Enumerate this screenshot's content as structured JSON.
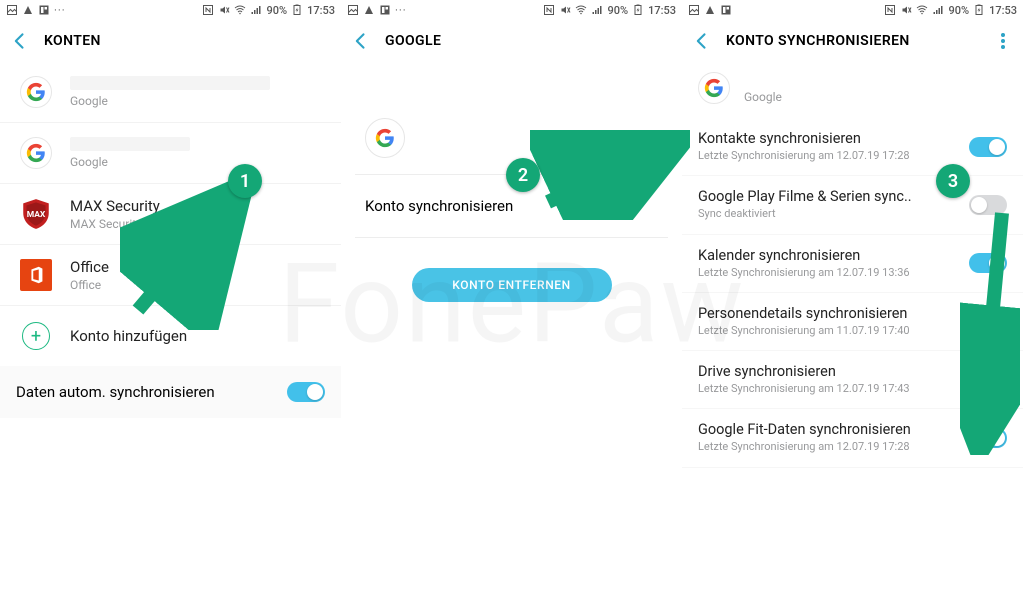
{
  "status": {
    "battery": "90%",
    "time": "17:53"
  },
  "screen1": {
    "title": "KONTEN",
    "accounts": [
      {
        "provider": "Google"
      },
      {
        "provider": "Google"
      },
      {
        "name": "MAX Security",
        "provider": "MAX Security"
      },
      {
        "name": "Office",
        "provider": "Office"
      }
    ],
    "add_account": "Konto hinzufügen",
    "auto_sync_label": "Daten autom. synchronisieren"
  },
  "screen2": {
    "title": "GOOGLE",
    "sync_label": "Konto synchronisieren",
    "remove_label": "KONTO ENTFERNEN"
  },
  "screen3": {
    "title": "KONTO SYNCHRONISIEREN",
    "provider": "Google",
    "items": [
      {
        "title": "Kontakte synchronisieren",
        "sub": "Letzte Synchronisierung am 12.07.19 17:28",
        "on": true
      },
      {
        "title": "Google Play Filme & Serien sync..",
        "sub": "Sync deaktiviert",
        "on": false
      },
      {
        "title": "Kalender synchronisieren",
        "sub": "Letzte Synchronisierung am 12.07.19 13:36",
        "on": true
      },
      {
        "title": "Personendetails synchronisieren",
        "sub": "Letzte Synchronisierung am 11.07.19 17:40",
        "on": true
      },
      {
        "title": "Drive synchronisieren",
        "sub": "Letzte Synchronisierung am 12.07.19 17:43",
        "on": true
      },
      {
        "title": "Google Fit-Daten synchronisieren",
        "sub": "Letzte Synchronisierung am 12.07.19 17:28",
        "on": true
      }
    ]
  },
  "annotations": [
    "1",
    "2",
    "3"
  ],
  "watermark": "FonePaw"
}
